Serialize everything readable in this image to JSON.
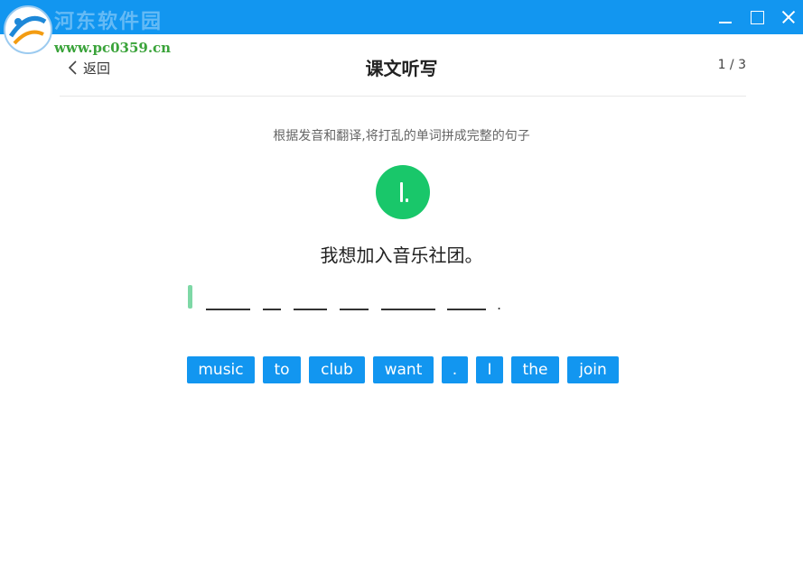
{
  "titlebar": {
    "color": "#1296f0"
  },
  "watermark": {
    "site_name": "河东软件园",
    "url": "www.pc0359.cn"
  },
  "header": {
    "back_label": "返回",
    "title": "课文听写",
    "progress": "1 / 3"
  },
  "exercise": {
    "instruction": "根据发音和翻译,将打乱的单词拼成完整的句子",
    "translation": "我想加入音乐社团。",
    "answer_end": "."
  },
  "word_bank": [
    "music",
    "to",
    "club",
    "want",
    ".",
    "I",
    "the",
    "join"
  ],
  "colors": {
    "accent": "#1296f0",
    "play": "#19c76a",
    "cursor": "#7ed8a6"
  }
}
